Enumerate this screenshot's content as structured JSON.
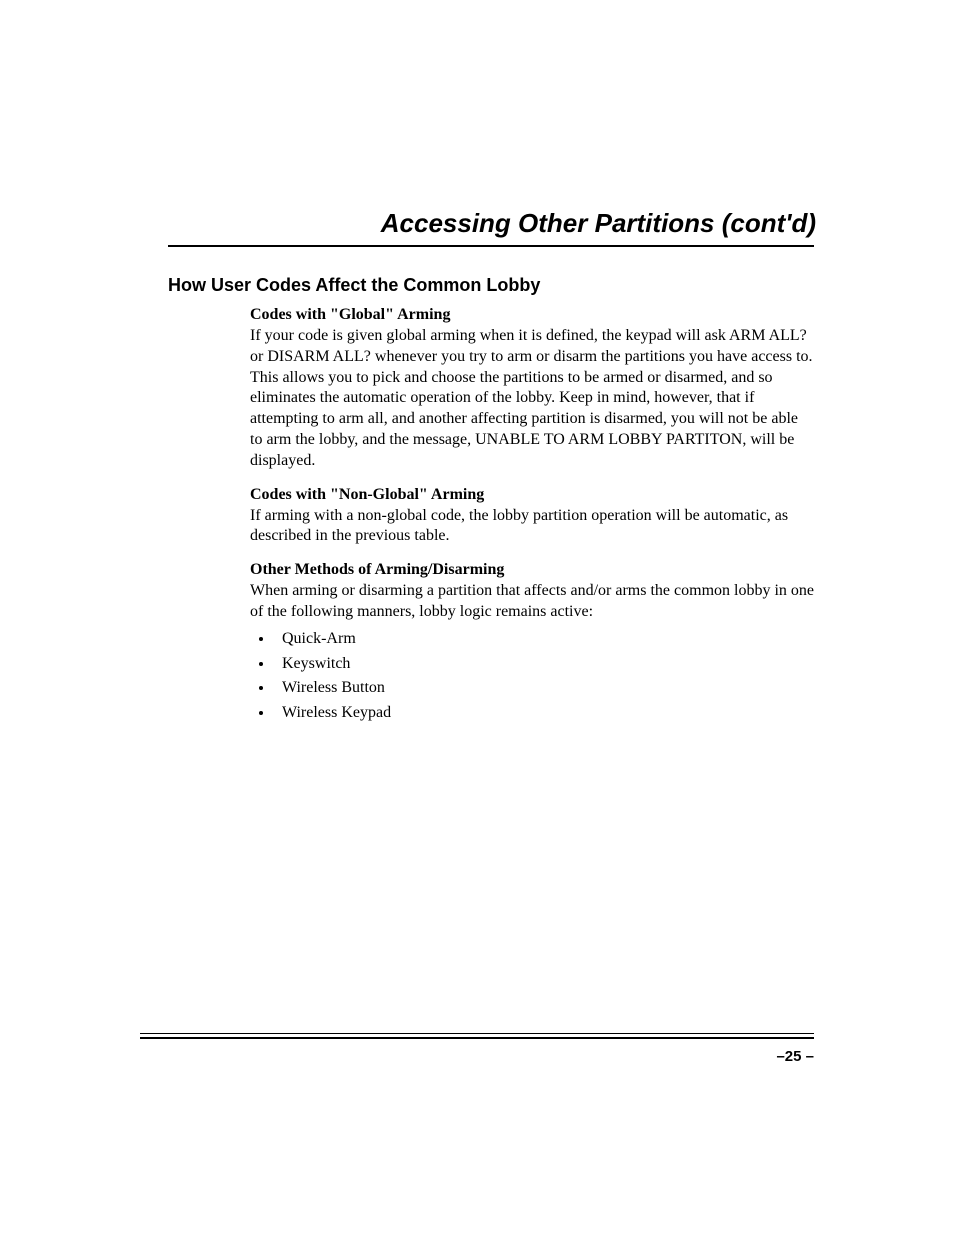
{
  "title": "Accessing Other Partitions (cont'd)",
  "sectionHeading": "How User Codes Affect the Common Lobby",
  "sub1": {
    "heading": "Codes with \"Global\" Arming",
    "body": "If your code is given global arming when it is defined, the keypad will ask ARM ALL? or DISARM ALL? whenever you try to arm or disarm the partitions you have access to.  This allows you to pick and choose the partitions to be armed or disarmed, and so eliminates the automatic operation of the lobby.  Keep in mind, however, that if attempting to arm all, and another affecting partition is disarmed, you will not be able to arm the lobby, and the message, UNABLE TO ARM LOBBY PARTITON, will be displayed."
  },
  "sub2": {
    "heading": "Codes with \"Non-Global\" Arming",
    "body": "If arming with a non-global code, the lobby partition operation will be automatic, as described in the previous table."
  },
  "sub3": {
    "heading": "Other Methods of Arming/Disarming",
    "body": "When arming or disarming a partition that affects and/or arms the common lobby in one of the following manners, lobby logic remains active:",
    "items": [
      "Quick-Arm",
      "Keyswitch",
      "Wireless Button",
      "Wireless Keypad"
    ]
  },
  "pageNumber": "–25 –"
}
